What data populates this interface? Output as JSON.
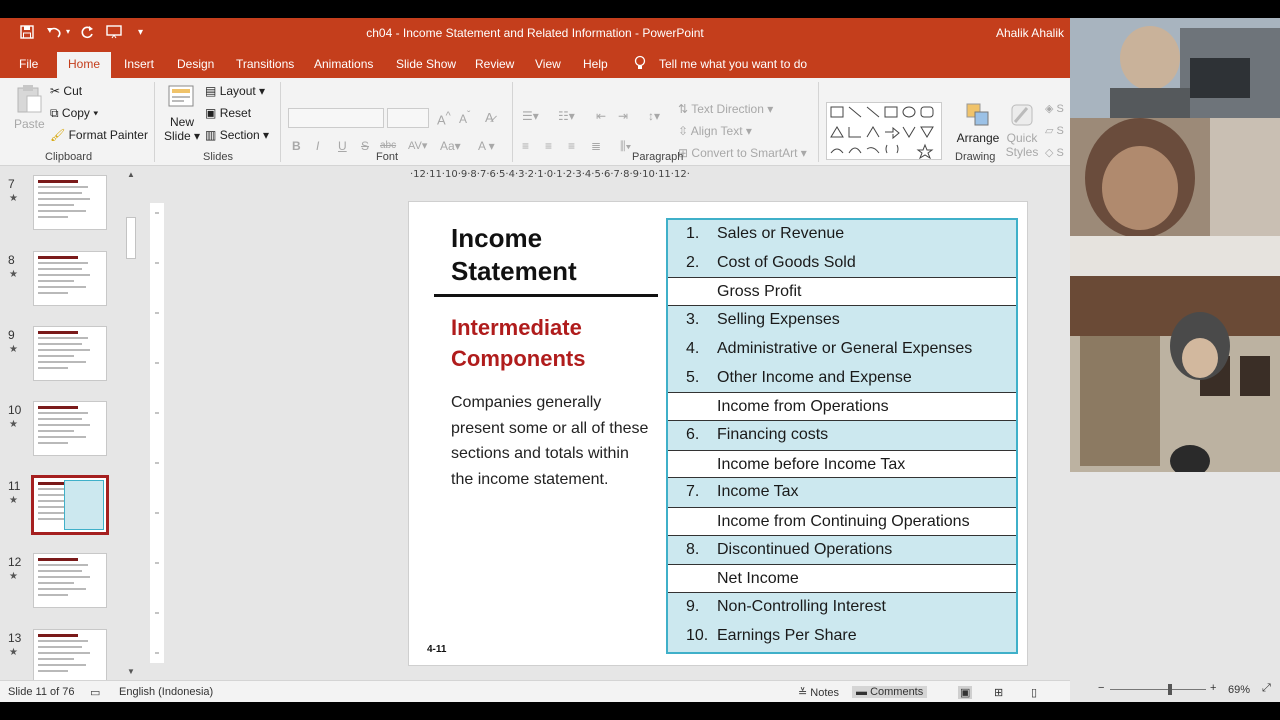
{
  "window": {
    "title": "ch04 - Income Statement and Related Information - PowerPoint",
    "user": "Ahalik Ahalik"
  },
  "tabs": [
    {
      "label": "File"
    },
    {
      "label": "Home"
    },
    {
      "label": "Insert"
    },
    {
      "label": "Design"
    },
    {
      "label": "Transitions"
    },
    {
      "label": "Animations"
    },
    {
      "label": "Slide Show"
    },
    {
      "label": "Review"
    },
    {
      "label": "View"
    },
    {
      "label": "Help"
    }
  ],
  "tell_me": "Tell me what you want to do",
  "ribbon": {
    "clipboard": {
      "paste": "Paste",
      "cut": "Cut",
      "copy": "Copy",
      "format_painter": "Format Painter",
      "group": "Clipboard"
    },
    "slides": {
      "new_slide_1": "New",
      "new_slide_2": "Slide",
      "layout": "Layout",
      "reset": "Reset",
      "section": "Section",
      "group": "Slides"
    },
    "font": {
      "group": "Font"
    },
    "paragraph": {
      "text_direction": "Text Direction",
      "align_text": "Align Text",
      "convert_smartart": "Convert to SmartArt",
      "group": "Paragraph"
    },
    "drawing": {
      "arrange": "Arrange",
      "quick_styles_1": "Quick",
      "quick_styles_2": "Styles",
      "group": "Drawing"
    }
  },
  "thumbnails": [
    {
      "num": "7",
      "star": "★"
    },
    {
      "num": "8",
      "star": "★"
    },
    {
      "num": "9",
      "star": "★"
    },
    {
      "num": "10",
      "star": "★"
    },
    {
      "num": "11",
      "star": "★"
    },
    {
      "num": "12",
      "star": "★"
    },
    {
      "num": "13",
      "star": "★"
    }
  ],
  "ruler_text": "·12·11·10·9·8·7·6·5·4·3·2·1·0·1·2·3·4·5·6·7·8·9·10·11·12·",
  "slide": {
    "title_line1": "Income",
    "title_line2": "Statement",
    "subtitle_line1": "Intermediate",
    "subtitle_line2": "Components",
    "body": "Companies generally present some or all of these sections and totals within the income statement.",
    "page_number": "4-11",
    "rows": [
      {
        "num": "1.",
        "text": "Sales or Revenue",
        "total": false
      },
      {
        "num": "2.",
        "text": "Cost of Goods Sold",
        "total": false
      },
      {
        "num": "",
        "text": "Gross Profit",
        "total": true
      },
      {
        "num": "3.",
        "text": "Selling Expenses",
        "total": false
      },
      {
        "num": "4.",
        "text": "Administrative or General Expenses",
        "total": false
      },
      {
        "num": "5.",
        "text": "Other Income and Expense",
        "total": false
      },
      {
        "num": "",
        "text": "Income from Operations",
        "total": true
      },
      {
        "num": "6.",
        "text": "Financing costs",
        "total": false
      },
      {
        "num": "",
        "text": "Income before Income Tax",
        "total": true
      },
      {
        "num": "7.",
        "text": "Income Tax",
        "total": false
      },
      {
        "num": "",
        "text": "Income from Continuing Operations",
        "total": true
      },
      {
        "num": "8.",
        "text": "Discontinued Operations",
        "total": false
      },
      {
        "num": "",
        "text": "Net Income",
        "total": true
      },
      {
        "num": "9.",
        "text": "Non-Controlling Interest",
        "total": false
      },
      {
        "num": "10.",
        "text": "Earnings Per Share",
        "total": false
      }
    ]
  },
  "status": {
    "slide_info": "Slide 11 of 76",
    "language": "English (Indonesia)",
    "notes": "Notes",
    "comments": "Comments",
    "zoom": "69%"
  },
  "colors": {
    "accent": "#c43e1c",
    "table_fill": "#cce8ef",
    "table_border": "#3fb0c9",
    "subtitle": "#b01c1c"
  }
}
